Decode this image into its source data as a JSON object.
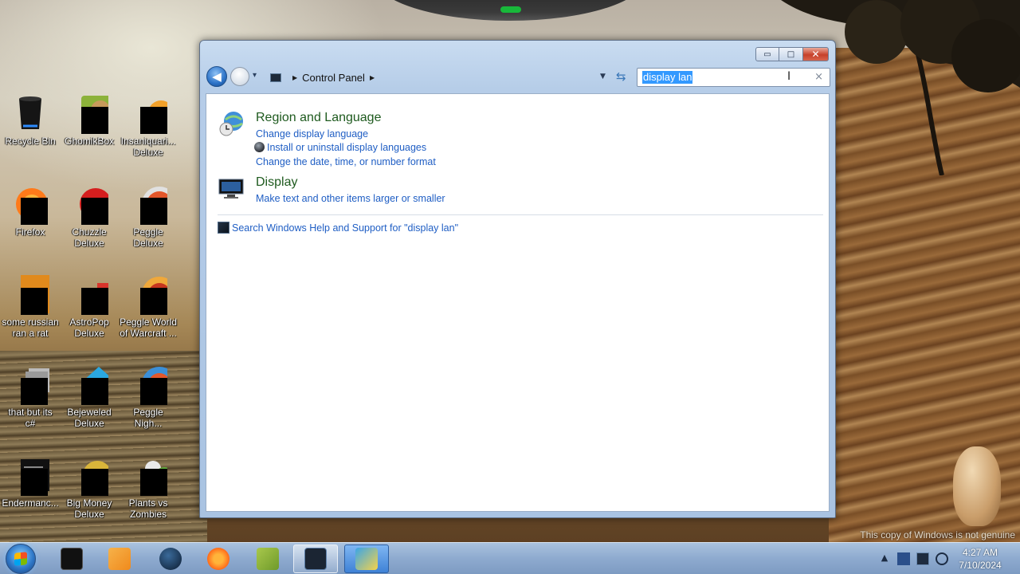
{
  "desktop": {
    "watermark": "This copy of Windows is not genuine",
    "icons": [
      {
        "label_l1": "Recycle Bin",
        "label_l2": ""
      },
      {
        "label_l1": "GhomikBox",
        "label_l2": ""
      },
      {
        "label_l1": "Insaniquari...",
        "label_l2": "Deluxe"
      },
      {
        "label_l1": "Firefox",
        "label_l2": ""
      },
      {
        "label_l1": "Chuzzle",
        "label_l2": "Deluxe"
      },
      {
        "label_l1": "Peggle",
        "label_l2": "Deluxe"
      },
      {
        "label_l1": "some russian",
        "label_l2": "ran a rat"
      },
      {
        "label_l1": "AstroPop",
        "label_l2": "Deluxe"
      },
      {
        "label_l1": "Peggle World",
        "label_l2": "of Warcraft ..."
      },
      {
        "label_l1": "that but its",
        "label_l2": "c#"
      },
      {
        "label_l1": "Bejeweled",
        "label_l2": "Deluxe"
      },
      {
        "label_l1": "Peggle",
        "label_l2": "Nigh..."
      },
      {
        "label_l1": "Endermanc...",
        "label_l2": ""
      },
      {
        "label_l1": "Big Money",
        "label_l2": "Deluxe"
      },
      {
        "label_l1": "Plants vs",
        "label_l2": "Zombies"
      }
    ]
  },
  "window": {
    "caption": {
      "minimize": "▭",
      "maximize": "□",
      "close": "✕"
    },
    "nav": {
      "back": "◀",
      "history": "▾"
    },
    "address": {
      "crumb_arrow": "▶",
      "crumb": "Control Panel",
      "dropdown": "▼",
      "refresh": "⇆"
    },
    "search": {
      "value": "display lan",
      "clear": "×",
      "caret": "I"
    },
    "results": [
      {
        "title": "Region and Language",
        "links": [
          {
            "text": "Change display language",
            "shield": false
          },
          {
            "text": "Install or uninstall display languages",
            "shield": true
          },
          {
            "text": "Change the date, time, or number format",
            "shield": false
          }
        ]
      },
      {
        "title": "Display",
        "links": [
          {
            "text": "Make text and other items larger or smaller",
            "shield": false
          }
        ]
      }
    ],
    "help_link": "Search Windows Help and Support for \"display lan\""
  },
  "taskbar": {
    "tray_up": "▲",
    "clock_time": "4:27 AM",
    "clock_date": "7/10/2024"
  },
  "colors": {
    "link": "#1f5ec4",
    "result_title": "#1e5a1e",
    "selection": "#3399ff"
  }
}
